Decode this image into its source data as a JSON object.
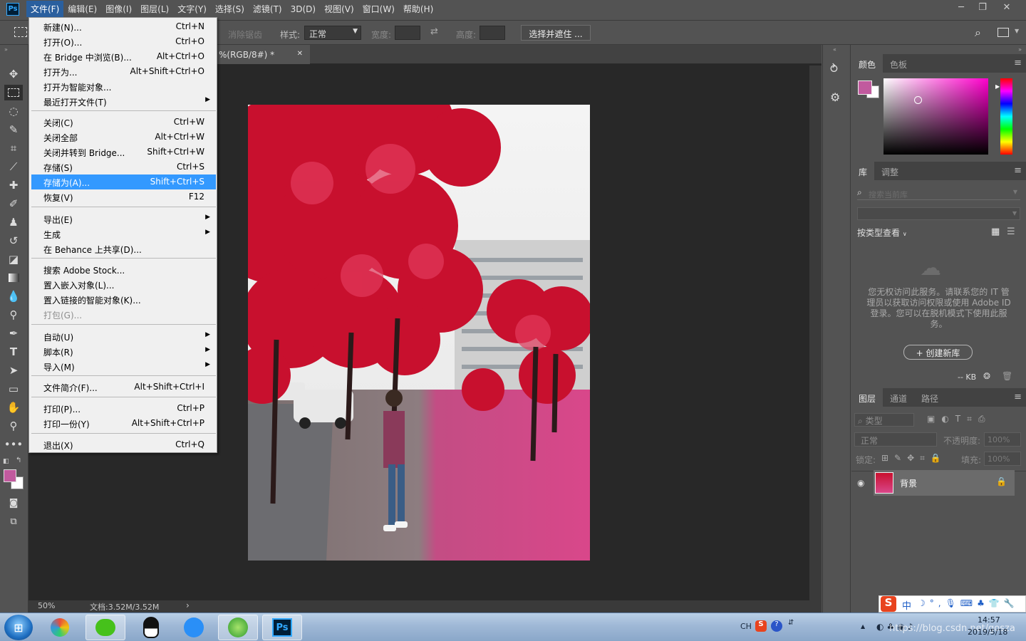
{
  "app": {
    "logo": "Ps",
    "window_controls": [
      "minimize-icon",
      "restore-icon",
      "close-icon"
    ]
  },
  "menubar": [
    "文件(F)",
    "编辑(E)",
    "图像(I)",
    "图层(L)",
    "文字(Y)",
    "选择(S)",
    "滤镜(T)",
    "3D(D)",
    "视图(V)",
    "窗口(W)",
    "帮助(H)"
  ],
  "options": {
    "antialias": "消除锯齿",
    "style_label": "样式:",
    "style_value": "正常",
    "width_label": "宽度:",
    "height_label": "高度:",
    "select_mask": "选择并遮住 ..."
  },
  "document": {
    "tab_title": "%(RGB/8#) *",
    "zoom": "50%",
    "doc_info": "文档:3.52M/3.52M"
  },
  "file_menu": [
    {
      "label": "新建(N)...",
      "shortcut": "Ctrl+N"
    },
    {
      "label": "打开(O)...",
      "shortcut": "Ctrl+O"
    },
    {
      "label": "在 Bridge 中浏览(B)...",
      "shortcut": "Alt+Ctrl+O"
    },
    {
      "label": "打开为...",
      "shortcut": "Alt+Shift+Ctrl+O"
    },
    {
      "label": "打开为智能对象...",
      "shortcut": ""
    },
    {
      "label": "最近打开文件(T)",
      "shortcut": ""
    },
    {
      "label": "关闭(C)",
      "shortcut": "Ctrl+W"
    },
    {
      "label": "关闭全部",
      "shortcut": "Alt+Ctrl+W"
    },
    {
      "label": "关闭并转到 Bridge...",
      "shortcut": "Shift+Ctrl+W"
    },
    {
      "label": "存储(S)",
      "shortcut": "Ctrl+S"
    },
    {
      "label": "存储为(A)...",
      "shortcut": "Shift+Ctrl+S"
    },
    {
      "label": "恢复(V)",
      "shortcut": "F12"
    },
    {
      "label": "导出(E)",
      "shortcut": ""
    },
    {
      "label": "生成",
      "shortcut": ""
    },
    {
      "label": "在 Behance 上共享(D)...",
      "shortcut": ""
    },
    {
      "label": "搜索 Adobe Stock...",
      "shortcut": ""
    },
    {
      "label": "置入嵌入对象(L)...",
      "shortcut": ""
    },
    {
      "label": "置入链接的智能对象(K)...",
      "shortcut": ""
    },
    {
      "label": "打包(G)...",
      "shortcut": ""
    },
    {
      "label": "自动(U)",
      "shortcut": ""
    },
    {
      "label": "脚本(R)",
      "shortcut": ""
    },
    {
      "label": "导入(M)",
      "shortcut": ""
    },
    {
      "label": "文件简介(F)...",
      "shortcut": "Alt+Shift+Ctrl+I"
    },
    {
      "label": "打印(P)...",
      "shortcut": "Ctrl+P"
    },
    {
      "label": "打印一份(Y)",
      "shortcut": "Alt+Shift+Ctrl+P"
    },
    {
      "label": "退出(X)",
      "shortcut": "Ctrl+Q"
    }
  ],
  "panels": {
    "color_tabs": [
      "颜色",
      "色板"
    ],
    "library_tabs": [
      "库",
      "调整"
    ],
    "lib_search_placeholder": "搜索当前库",
    "view_by_type": "按类型查看",
    "no_access_msg": "您无权访问此服务。请联系您的 IT 管理员以获取访问权限或使用 Adobe ID 登录。您可以在脱机模式下使用此服务。",
    "create_lib": "+ 创建新库",
    "kb": "-- KB",
    "layer_tabs": [
      "图层",
      "通道",
      "路径"
    ],
    "kind": "类型",
    "blend": "正常",
    "opacity_label": "不透明度:",
    "opacity": "100%",
    "lock_label": "锁定:",
    "fill_label": "填充:",
    "fill": "100%",
    "layer_name": "背景"
  },
  "colors": {
    "foreground": "#c15a9e",
    "background": "#ffffff",
    "picker_hue": "#ff00cc"
  },
  "ime": {
    "mode": "中"
  },
  "taskbar": {
    "tray_lang": "CH",
    "time": "14:57",
    "date": "2019/5/18",
    "watermark": "https://blog.csdn.net/gosza"
  }
}
